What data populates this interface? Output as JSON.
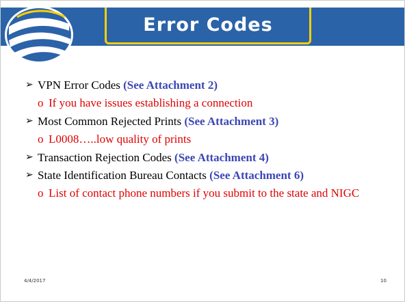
{
  "slide": {
    "title": "Error Codes",
    "bullets": [
      {
        "text": "VPN Error Codes ",
        "ref": "(See Attachment 2)",
        "sub": [
          "If you have issues establishing a connection"
        ]
      },
      {
        "text": "Most Common Rejected Prints  ",
        "ref": "(See Attachment 3)",
        "sub": [
          "L0008…..low quality of prints"
        ]
      },
      {
        "text": "Transaction Rejection Codes ",
        "ref": "(See Attachment 4)",
        "sub": []
      },
      {
        "text": "State Identification Bureau Contacts ",
        "ref": "(See Attachment 6)",
        "sub": [
          "List of contact phone numbers if you submit to the state and NIGC"
        ]
      }
    ],
    "footer": {
      "date": "4/4/2017",
      "page": "10"
    }
  },
  "colors": {
    "title_bg": "#2b63a8",
    "title_border": "#ffd000",
    "ref": "#3c46b4",
    "sub": "#e00000"
  },
  "icons": {
    "bullet": "arrow-bullet-icon",
    "sub_bullet": "circle-bullet-icon"
  }
}
